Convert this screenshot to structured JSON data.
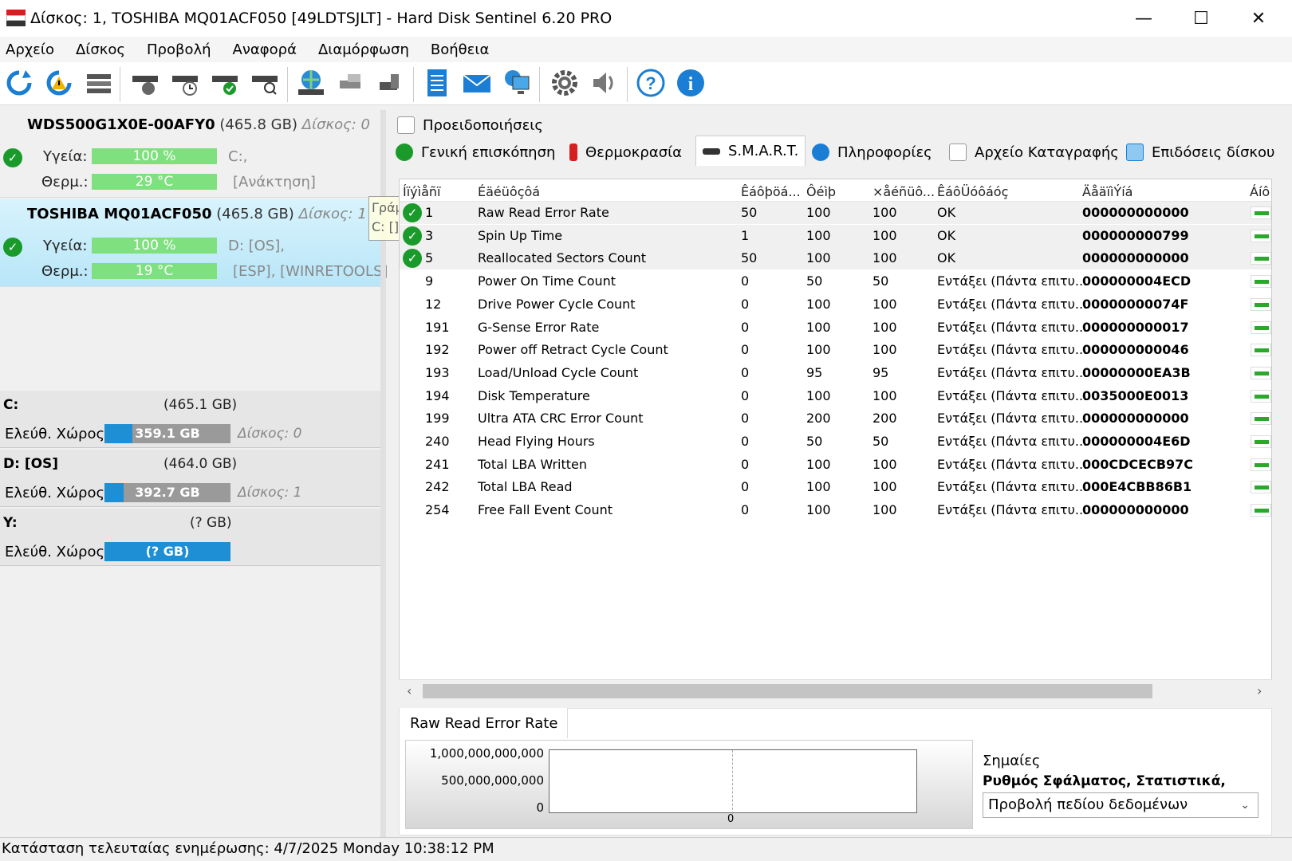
{
  "window": {
    "title": "Δίσκος: 1, TOSHIBA MQ01ACF050 [49LDTSJLT]  -  Hard Disk Sentinel 6.20 PRO",
    "minimize": "—",
    "maximize": "☐",
    "close": "✕"
  },
  "menu": [
    "Αρχείο",
    "Δίσκος",
    "Προβολή",
    "Αναφορά",
    "Διαμόρφωση",
    "Βοήθεια"
  ],
  "disks": [
    {
      "model": "WDS500G1X0E-00AFY0",
      "capacity": "(465.8 GB)",
      "disk_no": "Δίσκος: 0",
      "health_label": "Υγεία:",
      "health": "100 %",
      "health_pct": 100,
      "temp_label": "Θερμ.:",
      "temp": "29 °C",
      "partitions": "C:,",
      "partitions2": "[Ανάκτηση]"
    },
    {
      "model": "TOSHIBA MQ01ACF050",
      "capacity": "(465.8 GB)",
      "disk_no": "Δίσκος: 1",
      "health_label": "Υγεία:",
      "health": "100 %",
      "health_pct": 100,
      "temp_label": "Θερμ.:",
      "temp": "19 °C",
      "partitions": "D: [OS],",
      "partitions2": "[ESP],  [WINRETOOLS]"
    }
  ],
  "tooltip": {
    "line1": "Γράμμα σκληρού δίσκου",
    "line2": "C: [] NTFS"
  },
  "volumes": [
    {
      "name": "C:",
      "size": "(465.1 GB)",
      "free_label": "Ελεύθ. Χώρος",
      "free": "359.1 GB",
      "fill_pct": 22,
      "disk": "Δίσκος: 0"
    },
    {
      "name": "D: [OS]",
      "size": "(464.0 GB)",
      "free_label": "Ελεύθ. Χώρος",
      "free": "392.7 GB",
      "fill_pct": 15,
      "disk": "Δίσκος: 1"
    },
    {
      "name": "Y:",
      "size": "(? GB)",
      "free_label": "Ελεύθ. Χώρος",
      "free": "(? GB)",
      "fill_pct": 100,
      "disk": ""
    }
  ],
  "tabs_top": {
    "warnings": "Προειδοποιήσεις"
  },
  "tabs": [
    "Γενική επισκόπηση",
    "Θερμοκρασία",
    "S.M.A.R.T.",
    "Πληροφορίες",
    "Αρχείο Καταγραφής",
    "Επιδόσεις δίσκου"
  ],
  "smart_headers": [
    "Íïýìåñï",
    "Éäéüôçôá",
    "Êáôþöá...",
    "Ôéìþ",
    "×åéñüô...",
    "ÊáôÜóôáóç",
    "ÄåäïìÝíá",
    "Áíô"
  ],
  "smart_rows": [
    {
      "ok": true,
      "id": "1",
      "attr": "Raw Read Error Rate",
      "thr": "50",
      "val": "100",
      "worst": "100",
      "status": "OK",
      "raw": "000000000000"
    },
    {
      "ok": true,
      "id": "3",
      "attr": "Spin Up Time",
      "thr": "1",
      "val": "100",
      "worst": "100",
      "status": "OK",
      "raw": "000000000799"
    },
    {
      "ok": true,
      "id": "5",
      "attr": "Reallocated Sectors Count",
      "thr": "50",
      "val": "100",
      "worst": "100",
      "status": "OK",
      "raw": "000000000000"
    },
    {
      "ok": false,
      "id": "9",
      "attr": "Power On Time Count",
      "thr": "0",
      "val": "50",
      "worst": "50",
      "status": "Εντάξει (Πάντα επιτυ...",
      "raw": "000000004ECD"
    },
    {
      "ok": false,
      "id": "12",
      "attr": "Drive Power Cycle Count",
      "thr": "0",
      "val": "100",
      "worst": "100",
      "status": "Εντάξει (Πάντα επιτυ...",
      "raw": "00000000074F"
    },
    {
      "ok": false,
      "id": "191",
      "attr": "G-Sense Error Rate",
      "thr": "0",
      "val": "100",
      "worst": "100",
      "status": "Εντάξει (Πάντα επιτυ...",
      "raw": "000000000017"
    },
    {
      "ok": false,
      "id": "192",
      "attr": "Power off Retract Cycle Count",
      "thr": "0",
      "val": "100",
      "worst": "100",
      "status": "Εντάξει (Πάντα επιτυ...",
      "raw": "000000000046"
    },
    {
      "ok": false,
      "id": "193",
      "attr": "Load/Unload Cycle Count",
      "thr": "0",
      "val": "95",
      "worst": "95",
      "status": "Εντάξει (Πάντα επιτυ...",
      "raw": "00000000EA3B"
    },
    {
      "ok": false,
      "id": "194",
      "attr": "Disk Temperature",
      "thr": "0",
      "val": "100",
      "worst": "100",
      "status": "Εντάξει (Πάντα επιτυ...",
      "raw": "0035000E0013"
    },
    {
      "ok": false,
      "id": "199",
      "attr": "Ultra ATA CRC Error Count",
      "thr": "0",
      "val": "200",
      "worst": "200",
      "status": "Εντάξει (Πάντα επιτυ...",
      "raw": "000000000000"
    },
    {
      "ok": false,
      "id": "240",
      "attr": "Head Flying Hours",
      "thr": "0",
      "val": "50",
      "worst": "50",
      "status": "Εντάξει (Πάντα επιτυ...",
      "raw": "000000004E6D"
    },
    {
      "ok": false,
      "id": "241",
      "attr": "Total LBA Written",
      "thr": "0",
      "val": "100",
      "worst": "100",
      "status": "Εντάξει (Πάντα επιτυ...",
      "raw": "000CDCECB97C"
    },
    {
      "ok": false,
      "id": "242",
      "attr": "Total LBA Read",
      "thr": "0",
      "val": "100",
      "worst": "100",
      "status": "Εντάξει (Πάντα επιτυ...",
      "raw": "000E4CBB86B1"
    },
    {
      "ok": false,
      "id": "254",
      "attr": "Free Fall Event Count",
      "thr": "0",
      "val": "100",
      "worst": "100",
      "status": "Εντάξει (Πάντα επιτυ...",
      "raw": "000000000000"
    }
  ],
  "chart": {
    "tab": "Raw Read Error Rate",
    "y_ticks": [
      "1,000,000,000,000",
      "500,000,000,000",
      "0"
    ],
    "x_tick": "0"
  },
  "flags": {
    "label": "Σημαίες",
    "overlapped": "Ρυθμός Σφάλματος, Στατιστικά,",
    "select": "Προβολή πεδίου δεδομένων"
  },
  "status": "Κατάσταση τελευταίας ενημέρωσης: 4/7/2025 Monday 10:38:12 PM",
  "colors": {
    "ok_green": "#1a9a2a",
    "bar_green": "#7ee07e",
    "free_blue": "#1e8fd4",
    "selected_disk": "#cfeefa"
  }
}
